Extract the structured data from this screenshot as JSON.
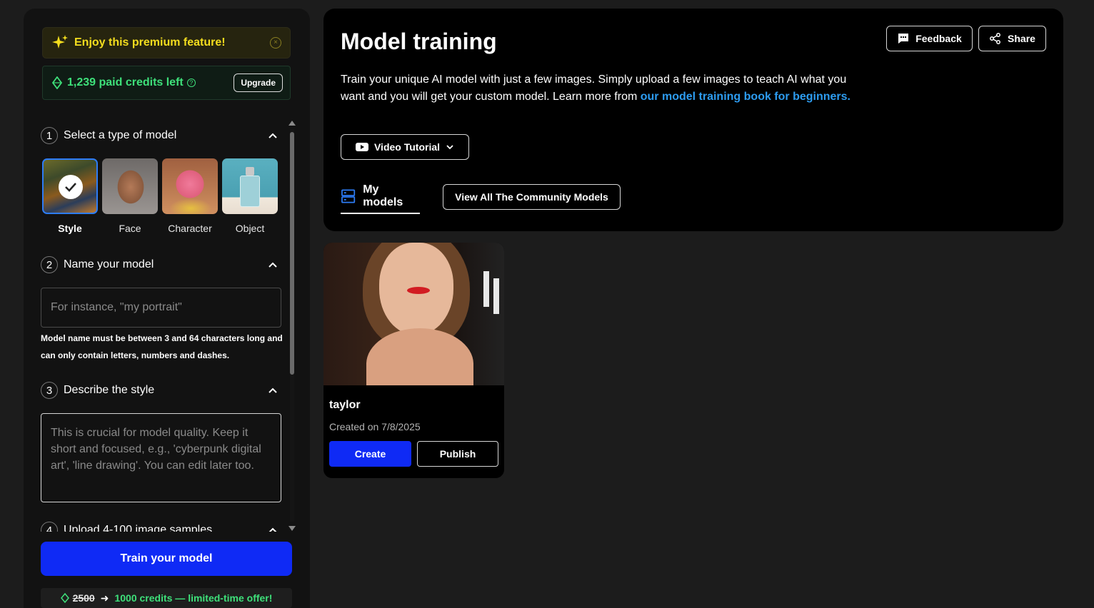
{
  "sidebar": {
    "promo": {
      "title": "Enjoy this premium feature!"
    },
    "credits": {
      "text": "1,239 paid credits left",
      "upgrade_label": "Upgrade"
    },
    "steps": [
      {
        "num": "1",
        "title": "Select a type of model"
      },
      {
        "num": "2",
        "title": "Name your model"
      },
      {
        "num": "3",
        "title": "Describe the style"
      },
      {
        "num": "4",
        "title": "Upload 4-100 image samples"
      }
    ],
    "model_types": [
      {
        "label": "Style",
        "selected": true
      },
      {
        "label": "Face",
        "selected": false
      },
      {
        "label": "Character",
        "selected": false
      },
      {
        "label": "Object",
        "selected": false
      }
    ],
    "name_input": {
      "value": "",
      "placeholder": "For instance, \"my portrait\""
    },
    "name_hint": "Model name must be between 3 and 64 characters long and can only contain letters, numbers and dashes.",
    "style_input": {
      "value": "",
      "placeholder": "This is crucial for model quality. Keep it short and focused, e.g., 'cyberpunk digital art', 'line drawing'. You can edit later too."
    },
    "train_label": "Train your model",
    "offer": {
      "old": "2500",
      "new": "1000 credits — limited-time offer!"
    }
  },
  "header": {
    "title": "Model training",
    "description": "Train your unique AI model with just a few images. Simply upload a few images to teach AI what you want and you will get your custom model. Learn more from ",
    "link_text": "our model training book for beginners.",
    "feedback_label": "Feedback",
    "share_label": "Share",
    "tutorial_label": "Video Tutorial",
    "tab_my_models": "My models",
    "community_label": "View All The Community Models"
  },
  "models": [
    {
      "name": "taylor",
      "created": "Created on 7/8/2025",
      "create_label": "Create",
      "publish_label": "Publish"
    }
  ],
  "colors": {
    "accent": "#0f2af5",
    "credits_green": "#3ee07a",
    "promo_yellow": "#f3dd1e",
    "link_blue": "#2d9cf0"
  }
}
